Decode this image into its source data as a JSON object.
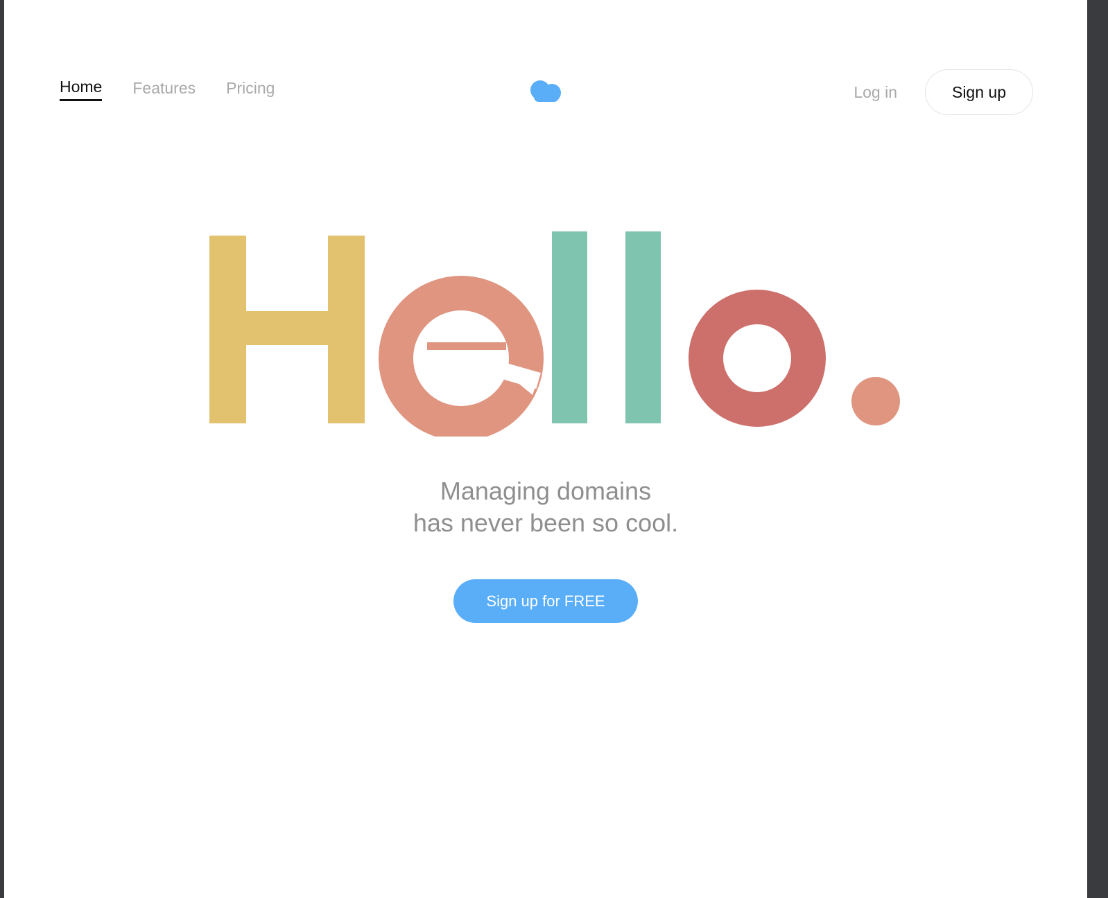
{
  "nav": {
    "items": [
      {
        "label": "Home",
        "active": true
      },
      {
        "label": "Features",
        "active": false
      },
      {
        "label": "Pricing",
        "active": false
      }
    ],
    "login_label": "Log in",
    "signup_label": "Sign up"
  },
  "logo": {
    "icon": "cloud-icon",
    "color": "#5aaef7"
  },
  "hero": {
    "word": "Hello.",
    "letter_colors": {
      "H": "#e2c16f",
      "e": "#df9580",
      "l": "#7fc4af",
      "o": "#cd706c",
      "dot": "#df9580"
    }
  },
  "tagline": {
    "line1": "Managing domains",
    "line2": "has never been so cool."
  },
  "cta": {
    "label": "Sign up for FREE",
    "color": "#5aaef7"
  }
}
